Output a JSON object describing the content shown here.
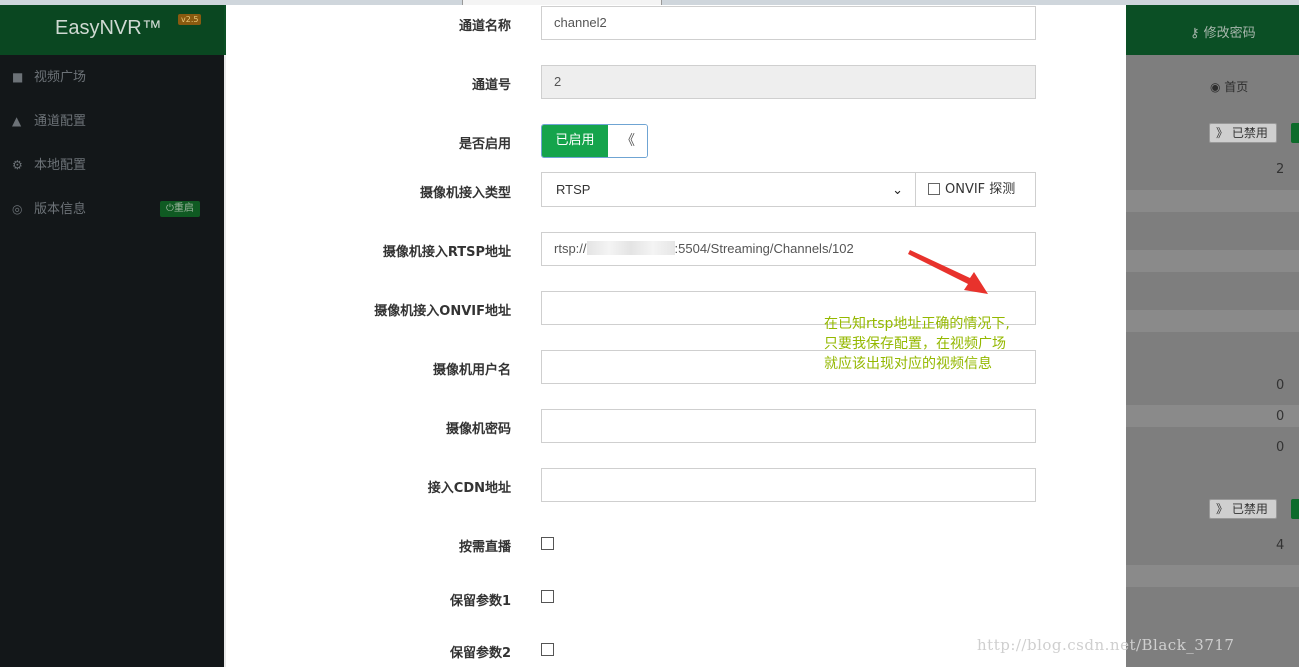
{
  "app": {
    "logo": "EasyNVR™",
    "version": "v2.5",
    "change_password": "修改密码"
  },
  "sidebar": {
    "items": [
      {
        "label": "视频广场",
        "icon": "video-camera-icon"
      },
      {
        "label": "通道配置",
        "icon": "road-icon"
      },
      {
        "label": "本地配置",
        "icon": "gears-icon"
      },
      {
        "label": "版本信息",
        "icon": "lifebuoy-icon"
      }
    ],
    "restart_label": "重启"
  },
  "background": {
    "breadcrumb": "首页",
    "disabled_label": "已禁用",
    "numbers": [
      "2",
      "0",
      "0",
      "0",
      "4"
    ]
  },
  "form": {
    "channel_name": {
      "label": "通道名称",
      "value": "channel2"
    },
    "channel_no": {
      "label": "通道号",
      "value": "2"
    },
    "enabled": {
      "label": "是否启用",
      "on_text": "已启用",
      "handle": "《"
    },
    "camera_type": {
      "label": "摄像机接入类型",
      "value": "RTSP",
      "onvif_probe": "ONVIF 探测"
    },
    "rtsp_url": {
      "label": "摄像机接入RTSP地址",
      "prefix": "rtsp://",
      "suffix": ":5504/Streaming/Channels/102"
    },
    "onvif_url": {
      "label": "摄像机接入ONVIF地址",
      "value": ""
    },
    "username": {
      "label": "摄像机用户名",
      "value": ""
    },
    "password": {
      "label": "摄像机密码",
      "value": ""
    },
    "cdn_url": {
      "label": "接入CDN地址",
      "value": ""
    },
    "on_demand": {
      "label": "按需直播"
    },
    "reserved1": {
      "label": "保留参数1"
    },
    "reserved2": {
      "label": "保留参数2"
    }
  },
  "annotation": {
    "lines": [
      "在已知rtsp地址正确的情况下,",
      "只要我保存配置，在视频广场",
      "就应该出现对应的视频信息"
    ],
    "color": "#94b800"
  },
  "watermark": "http://blog.csdn.net/Black_3717"
}
